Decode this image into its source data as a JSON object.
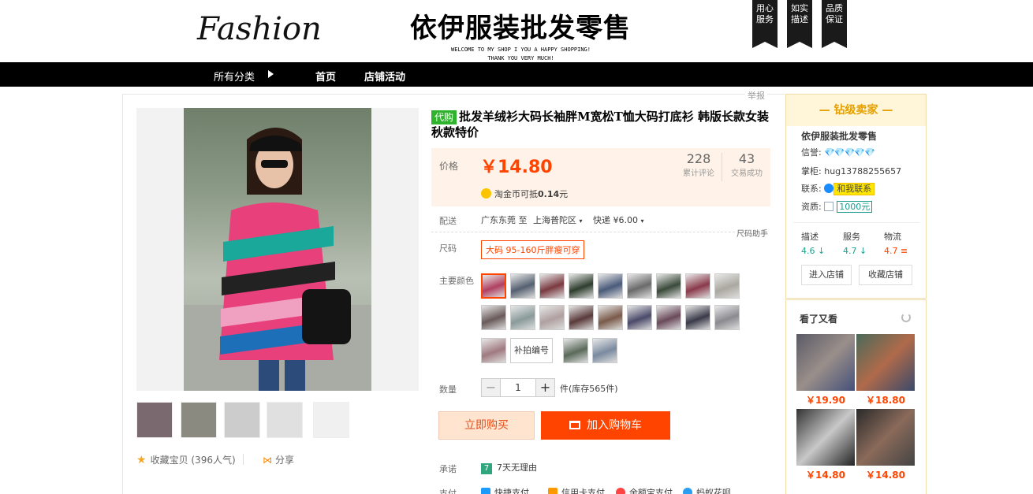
{
  "header": {
    "logo_text": "Fashion",
    "shop_title": "依伊服装批发零售",
    "welcome_line1": "WELCOME TO MY SHOP I YOU A HAPPY SHOPPING!",
    "welcome_line2": "THANK YOU VERY MUCH!",
    "promises": [
      "用心服务",
      "如实描述",
      "品质保证"
    ]
  },
  "nav": {
    "category": "所有分类",
    "items": [
      "首页",
      "店铺活动"
    ]
  },
  "report_label": "举报",
  "product": {
    "tag": "代购",
    "title": "批发羊绒衫大码长袖胖M宽松T恤大码打底衫 韩版长款女装秋款特价",
    "price_label": "价格",
    "price": "￥14.80",
    "reviews_count": "228",
    "reviews_label": "累计评论",
    "deals_count": "43",
    "deals_label": "交易成功",
    "coin_text": "淘金币可抵",
    "coin_value": "0.14",
    "coin_unit": "元",
    "ship_label": "配送",
    "ship_from": "广东东莞 至",
    "ship_to": "上海普陀区",
    "ship_method": "快递 ¥6.00",
    "size_help": "尺码助手",
    "size_label": "尺码",
    "size_option": "大码 95-160斤胖瘦可穿",
    "color_label": "主要颜色",
    "color_text_option": "补拍编号",
    "qty_label": "数量",
    "qty_value": "1",
    "qty_minus": "−",
    "qty_plus": "+",
    "stock_text": "件(库存565件)",
    "buy_now": "立即购买",
    "add_cart": "加入购物车",
    "promise_label": "承诺",
    "promise_icon": "7",
    "promise_text": "7天无理由",
    "pay_label": "支付",
    "pay_methods": [
      "快捷支付",
      "信用卡支付",
      "余额宝支付",
      "蚂蚁花呗"
    ]
  },
  "gallery": {
    "collect_text": "收藏宝贝 (396人气)",
    "share_text": "分享"
  },
  "seller": {
    "level": "钻级卖家",
    "name": "依伊服装批发零售",
    "credit_label": "信誉:",
    "credit_value": "💎💎💎💎💎",
    "owner_label": "掌柜:",
    "owner_value": "hug13788255657",
    "contact_label": "联系:",
    "contact_button": "和我联系",
    "deposit_label": "资质:",
    "deposit_value": "1000元",
    "dsr": [
      {
        "label": "描述",
        "value": "4.6 ↓"
      },
      {
        "label": "服务",
        "value": "4.7 ↓"
      },
      {
        "label": "物流",
        "value": "4.7 ≡"
      }
    ],
    "enter_shop": "进入店铺",
    "fav_shop": "收藏店铺"
  },
  "also_viewed": {
    "title": "看了又看",
    "prices": [
      "￥19.90",
      "￥18.80",
      "￥14.80",
      "￥14.80"
    ]
  },
  "colors": {
    "accent": "#ff4400",
    "brand_black": "#000000",
    "tag_green": "#30b32c",
    "price_bg": "#fff2e8"
  }
}
